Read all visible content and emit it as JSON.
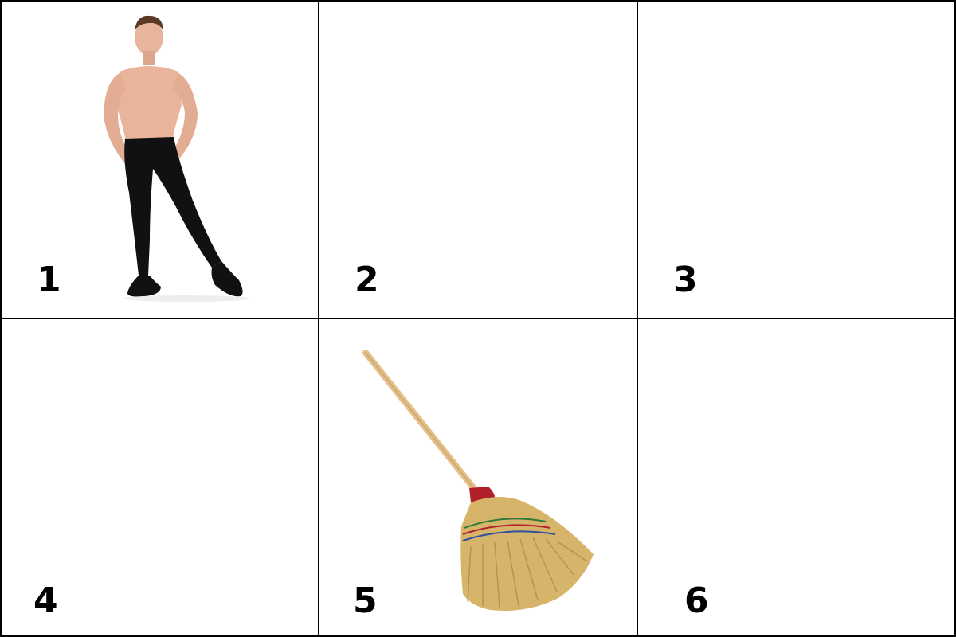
{
  "panels": [
    {
      "number": "1",
      "image": "dancer-icon"
    },
    {
      "number": "2",
      "image": ""
    },
    {
      "number": "3",
      "image": ""
    },
    {
      "number": "4",
      "image": ""
    },
    {
      "number": "5",
      "image": "broom-icon"
    },
    {
      "number": "6",
      "image": ""
    }
  ],
  "colors": {
    "border": "#000000",
    "background": "#ffffff",
    "skin": "#e8b49a",
    "tights": "#111111",
    "broom_straw": "#d6b46a",
    "broom_handle": "#e3c08a",
    "broom_cap": "#b3202a"
  }
}
